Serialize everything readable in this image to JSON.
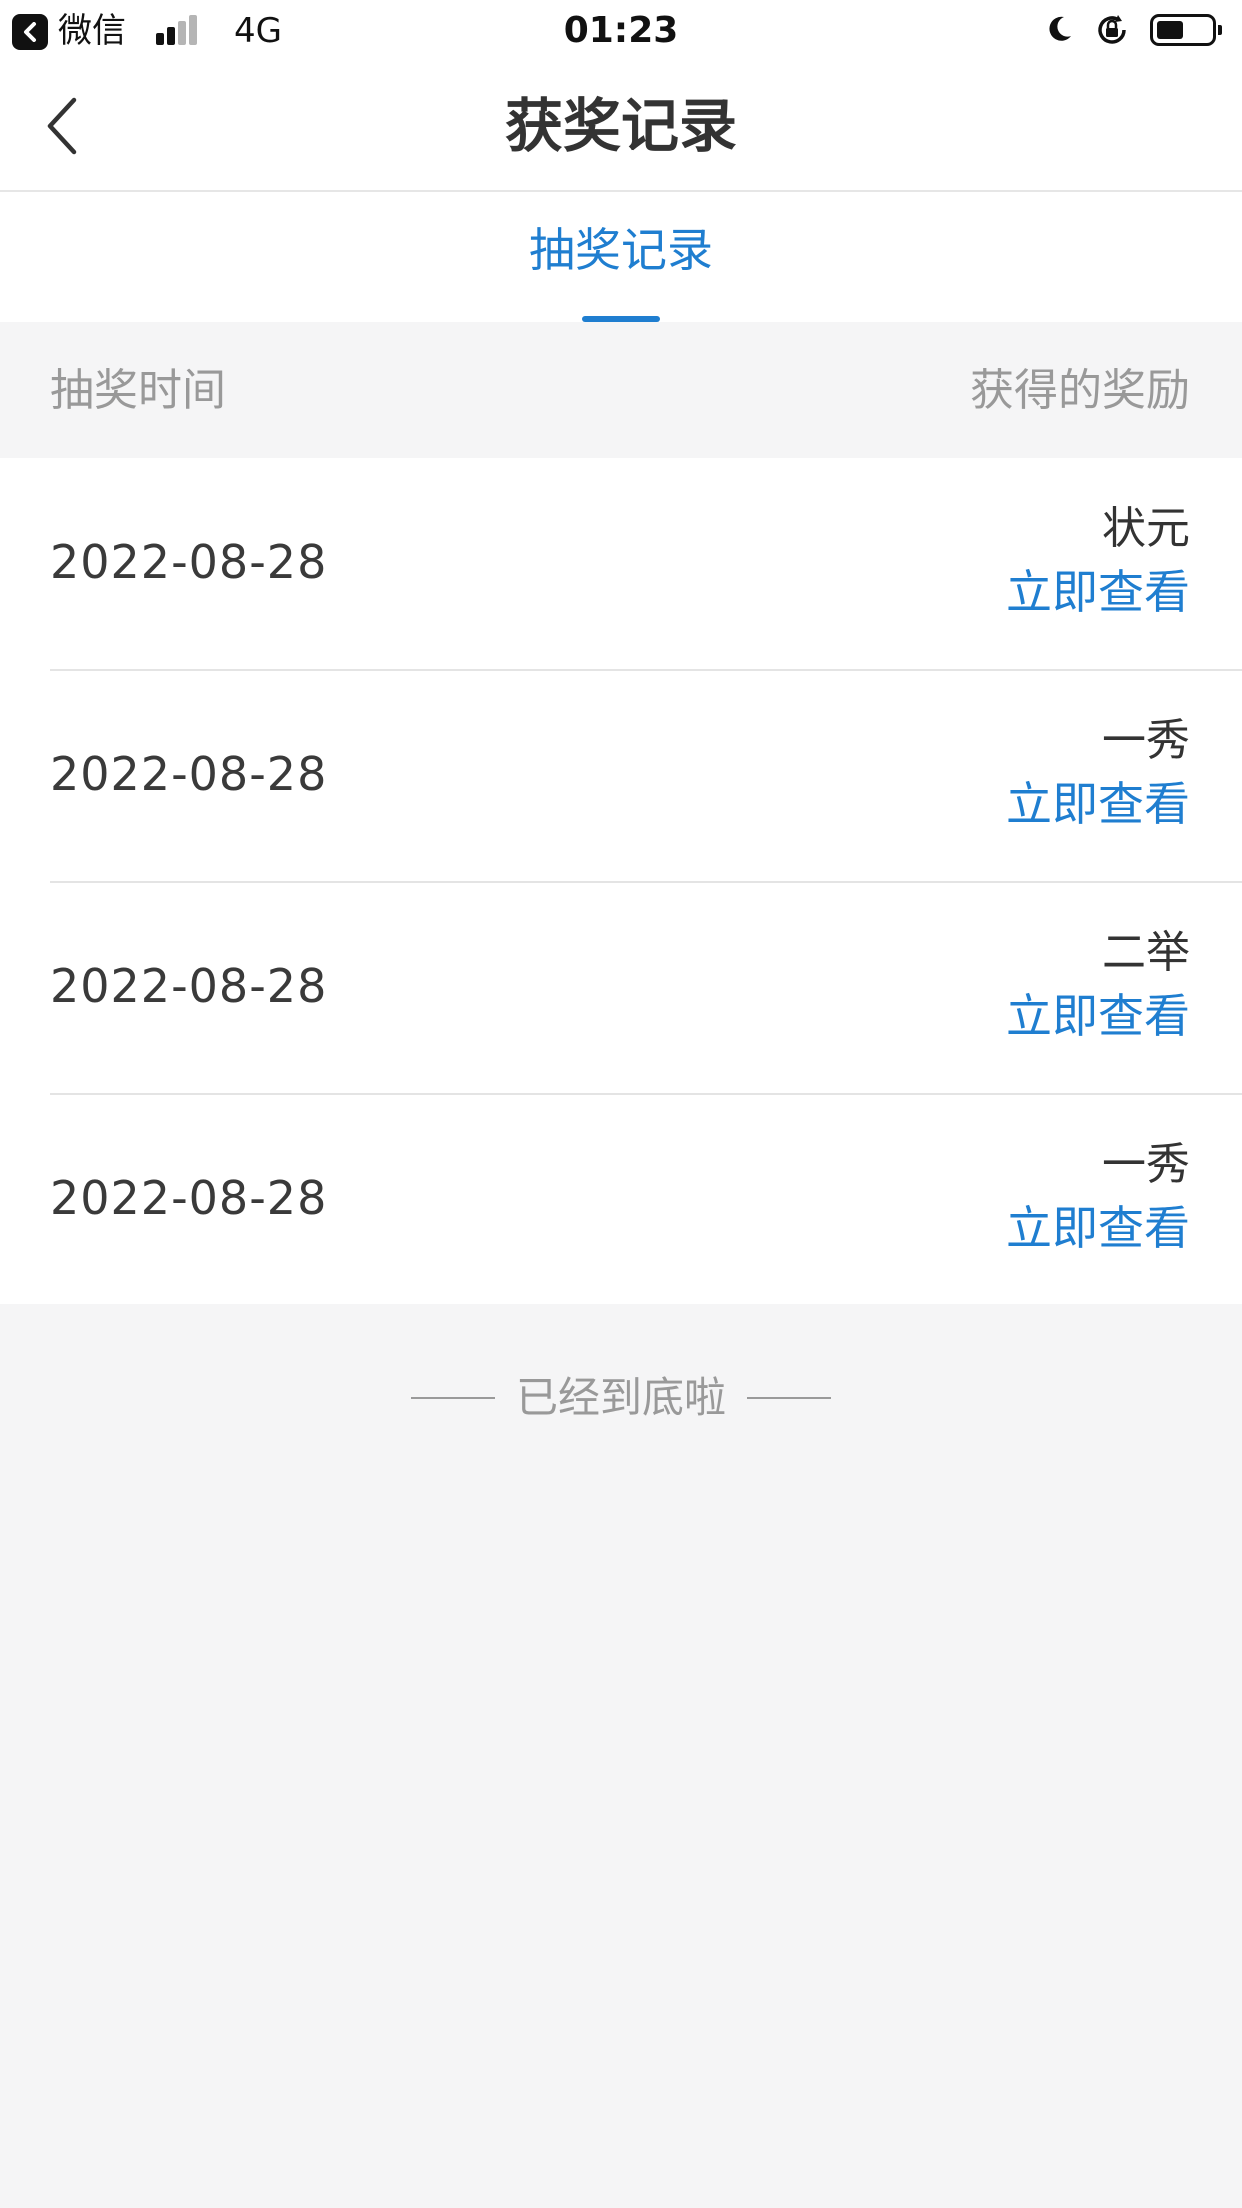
{
  "status_bar": {
    "app_name": "微信",
    "network": "4G",
    "time": "01:23",
    "battery_level": 0.5
  },
  "nav": {
    "title": "获奖记录",
    "back_icon": "chevron-left-icon"
  },
  "tabs": [
    {
      "label": "抽奖记录",
      "active": true
    }
  ],
  "columns": {
    "time_header": "抽奖时间",
    "reward_header": "获得的奖励"
  },
  "records": [
    {
      "date": "2022-08-28",
      "prize": "状元",
      "action": "立即查看"
    },
    {
      "date": "2022-08-28",
      "prize": "一秀",
      "action": "立即查看"
    },
    {
      "date": "2022-08-28",
      "prize": "二举",
      "action": "立即查看"
    },
    {
      "date": "2022-08-28",
      "prize": "一秀",
      "action": "立即查看"
    }
  ],
  "footer": {
    "end_text": "已经到底啦"
  },
  "colors": {
    "accent": "#1f7ed0",
    "background": "#f5f5f6",
    "muted_text": "#999999"
  }
}
